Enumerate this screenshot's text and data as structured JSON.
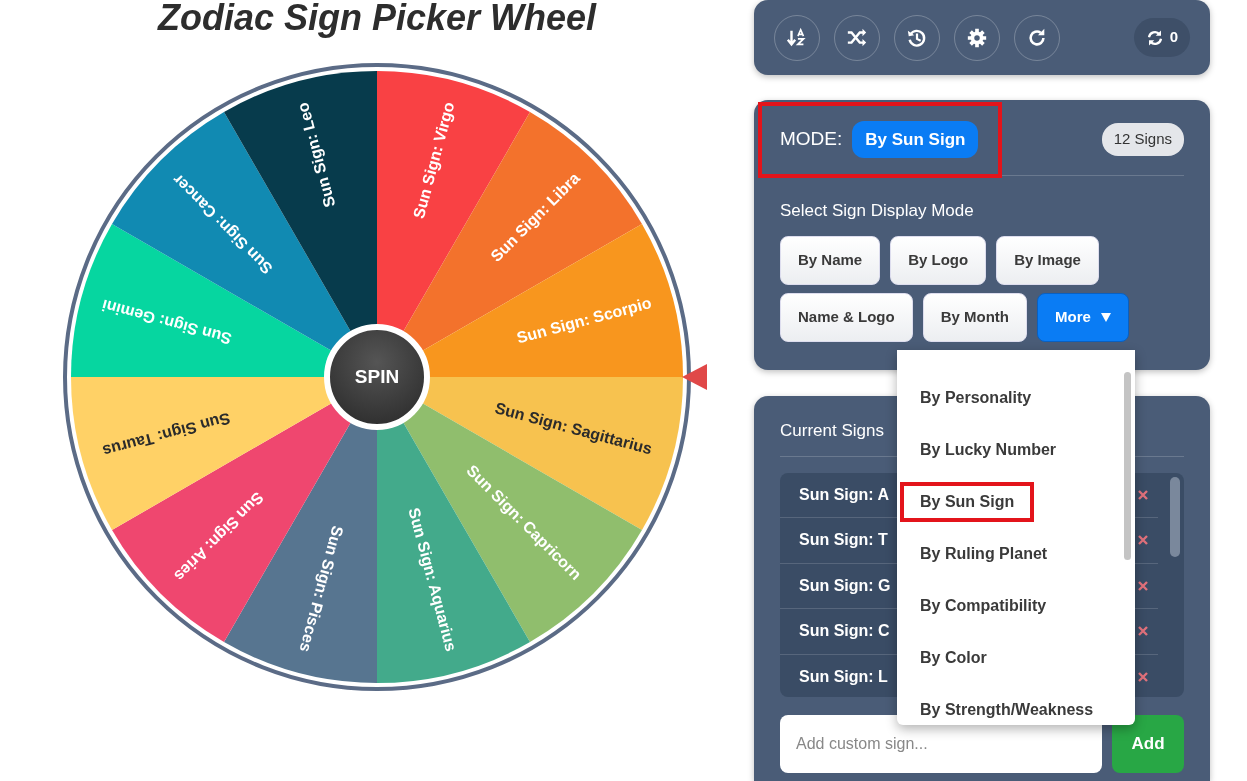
{
  "title": "Zodiac Sign Picker Wheel",
  "wheel": {
    "spin_label": "SPIN",
    "segments": [
      {
        "label": "Sun Sign: Sagittarius",
        "color": "#f7c24f"
      },
      {
        "label": "Sun Sign: Capricorn",
        "color": "#90be6d"
      },
      {
        "label": "Sun Sign: Aquarius",
        "color": "#43aa8b"
      },
      {
        "label": "Sun Sign: Pisces",
        "color": "#577590"
      },
      {
        "label": "Sun Sign: Aries",
        "color": "#ef476f"
      },
      {
        "label": "Sun Sign: Taurus",
        "color": "#ffd166"
      },
      {
        "label": "Sun Sign: Gemini",
        "color": "#06d6a0"
      },
      {
        "label": "Sun Sign: Cancer",
        "color": "#118ab2"
      },
      {
        "label": "Sun Sign: Leo",
        "color": "#073b4c"
      },
      {
        "label": "Sun Sign: Virgo",
        "color": "#f94144"
      },
      {
        "label": "Sun Sign: Libra",
        "color": "#f3722c"
      },
      {
        "label": "Sun Sign: Scorpio",
        "color": "#f8961e"
      }
    ]
  },
  "toolbar": {
    "buttons": [
      {
        "kind": "sort"
      },
      {
        "kind": "shuffle"
      },
      {
        "kind": "history"
      },
      {
        "kind": "settings"
      },
      {
        "kind": "redo"
      }
    ],
    "spin_count": "0"
  },
  "mode": {
    "label": "MODE:",
    "value": "By Sun Sign",
    "highlighted": true,
    "count": "12 Signs",
    "section_title": "Select Sign Display Mode",
    "buttons": [
      {
        "label": "By Name",
        "selected": false
      },
      {
        "label": "By Logo",
        "selected": false
      },
      {
        "label": "By Image",
        "selected": false
      },
      {
        "label": "Name & Logo",
        "selected": false
      },
      {
        "label": "By Month",
        "selected": false
      },
      {
        "label": "More",
        "selected": true,
        "kind": "dropdown"
      }
    ]
  },
  "dropdown": {
    "items": [
      {
        "label": "By Personality",
        "highlighted": false
      },
      {
        "label": "By Lucky Number",
        "highlighted": false
      },
      {
        "label": "By Sun Sign",
        "highlighted": true
      },
      {
        "label": "By Ruling Planet",
        "highlighted": false
      },
      {
        "label": "By Compatibility",
        "highlighted": false
      },
      {
        "label": "By Color",
        "highlighted": false
      },
      {
        "label": "By Strength/Weakness",
        "highlighted": false
      }
    ]
  },
  "signs": {
    "title": "Current Signs",
    "items": [
      {
        "label": "Sun Sign: A"
      },
      {
        "label": "Sun Sign: T"
      },
      {
        "label": "Sun Sign: G"
      },
      {
        "label": "Sun Sign: C"
      },
      {
        "label": "Sun Sign: L"
      }
    ],
    "input": {
      "placeholder": "Add custom sign..."
    },
    "add_button": "Add"
  }
}
